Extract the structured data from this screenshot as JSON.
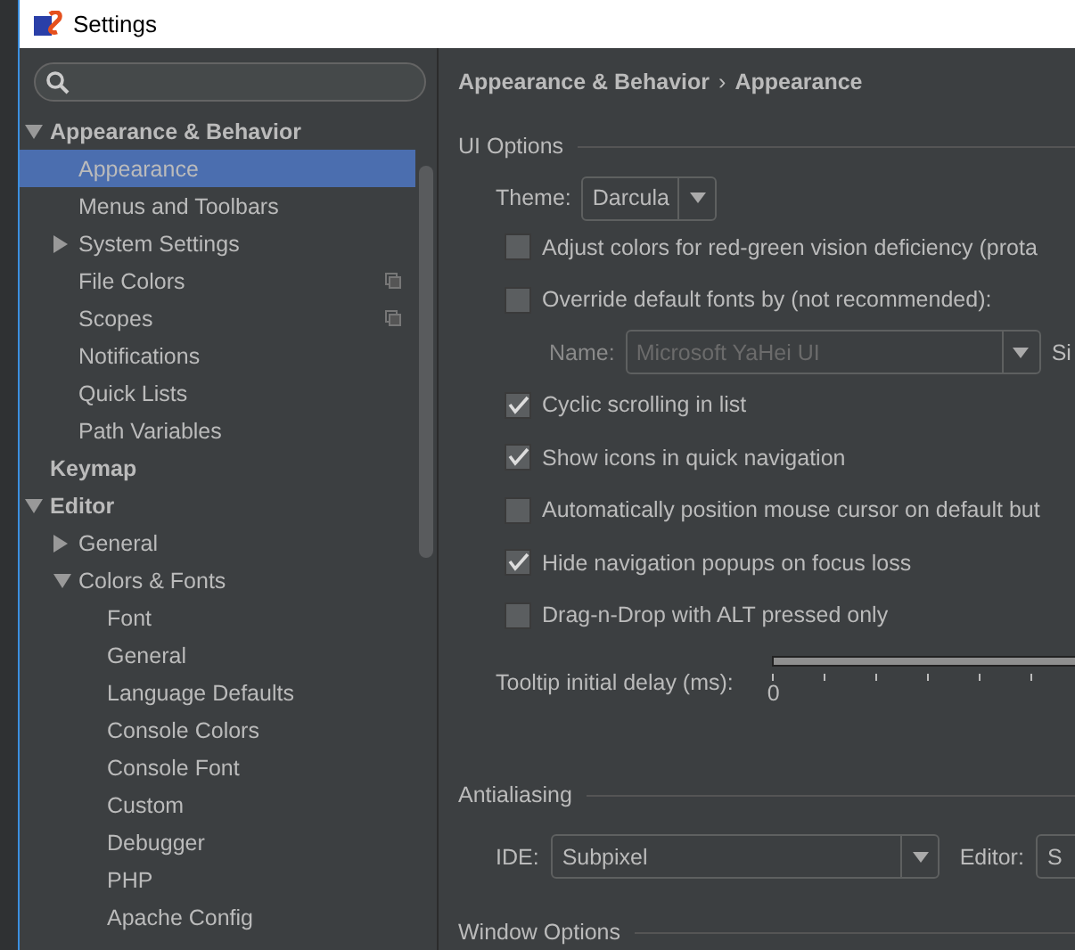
{
  "window": {
    "title": "Settings"
  },
  "tree": [
    {
      "label": "Appearance & Behavior",
      "expanded": true,
      "selected": false,
      "shared": false,
      "children": [
        {
          "label": "Appearance",
          "selected": true,
          "shared": false
        },
        {
          "label": "Menus and Toolbars",
          "selected": false,
          "shared": false
        },
        {
          "label": "System Settings",
          "expanded": false,
          "selected": false,
          "shared": false
        },
        {
          "label": "File Colors",
          "selected": false,
          "shared": true
        },
        {
          "label": "Scopes",
          "selected": false,
          "shared": true
        },
        {
          "label": "Notifications",
          "selected": false,
          "shared": false
        },
        {
          "label": "Quick Lists",
          "selected": false,
          "shared": false
        },
        {
          "label": "Path Variables",
          "selected": false,
          "shared": false
        }
      ]
    },
    {
      "label": "Keymap",
      "selected": false,
      "shared": false
    },
    {
      "label": "Editor",
      "expanded": true,
      "selected": false,
      "shared": false,
      "children": [
        {
          "label": "General",
          "expanded": false,
          "selected": false,
          "shared": false
        },
        {
          "label": "Colors & Fonts",
          "expanded": true,
          "selected": false,
          "shared": false,
          "children": [
            {
              "label": "Font",
              "selected": false,
              "shared": false
            },
            {
              "label": "General",
              "selected": false,
              "shared": false
            },
            {
              "label": "Language Defaults",
              "selected": false,
              "shared": false
            },
            {
              "label": "Console Colors",
              "selected": false,
              "shared": false
            },
            {
              "label": "Console Font",
              "selected": false,
              "shared": false
            },
            {
              "label": "Custom",
              "selected": false,
              "shared": false
            },
            {
              "label": "Debugger",
              "selected": false,
              "shared": false
            },
            {
              "label": "PHP",
              "selected": false,
              "shared": false
            },
            {
              "label": "Apache Config",
              "selected": false,
              "shared": false
            }
          ]
        }
      ]
    }
  ],
  "breadcrumb": {
    "parent": "Appearance & Behavior",
    "separator": "›",
    "current": "Appearance"
  },
  "ui_options": {
    "title": "UI Options",
    "theme": {
      "label": "Theme:",
      "value": "Darcula"
    },
    "options": [
      {
        "kind": "checkbox",
        "label": "Adjust colors for red-green vision deficiency (prota",
        "checked": false
      },
      {
        "kind": "checkbox",
        "label": "Override default fonts by (not recommended):",
        "checked": false
      },
      {
        "kind": "font",
        "label": "Name:",
        "value": "Microsoft YaHei UI",
        "disabled": true,
        "size_label": "Si"
      },
      {
        "kind": "checkbox",
        "label": "Cyclic scrolling in list",
        "checked": true
      },
      {
        "kind": "checkbox",
        "label": "Show icons in quick navigation",
        "checked": true
      },
      {
        "kind": "checkbox",
        "label": "Automatically position mouse cursor on default but",
        "checked": false
      },
      {
        "kind": "checkbox",
        "label": "Hide navigation popups on focus loss",
        "checked": true
      },
      {
        "kind": "checkbox",
        "label": "Drag-n-Drop with ALT pressed only",
        "checked": false
      }
    ],
    "tooltip_delay": {
      "label": "Tooltip initial delay (ms):",
      "tick_label": "0"
    }
  },
  "antialiasing": {
    "title": "Antialiasing",
    "ide": {
      "label": "IDE:",
      "value": "Subpixel"
    },
    "editor": {
      "label": "Editor:",
      "value": "S"
    }
  },
  "window_options": {
    "title": "Window Options"
  }
}
